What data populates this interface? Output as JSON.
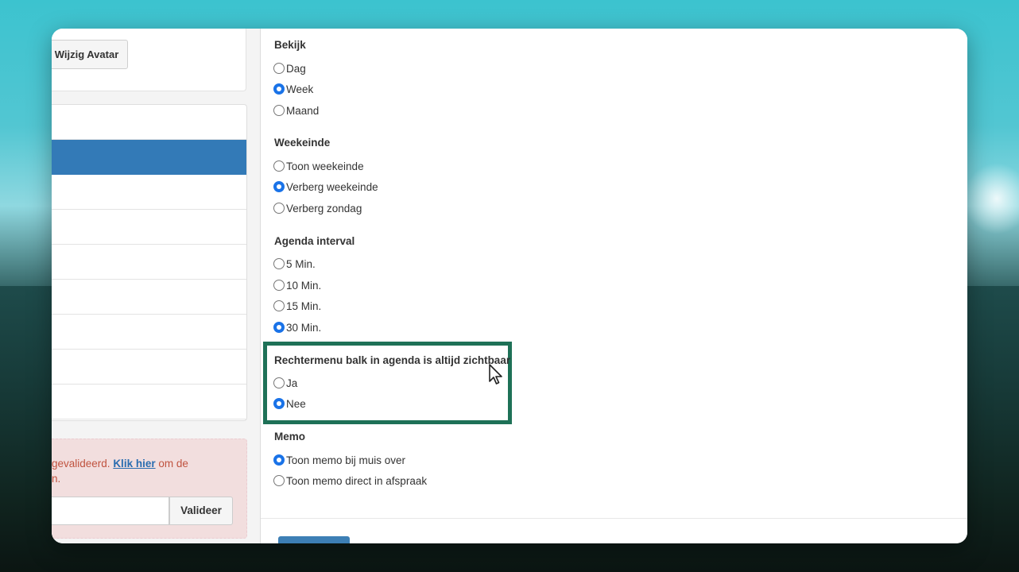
{
  "left": {
    "avatar_button_label": "Wijzig Avatar",
    "alert": {
      "text_prefix": "gevalideerd. ",
      "link_text": "Klik hier",
      "text_suffix": " om de",
      "line2": "n.",
      "validate_button": "Valideer",
      "input_value": ""
    }
  },
  "settings": {
    "view": {
      "title": "Bekijk",
      "options": [
        {
          "label": "Dag",
          "checked": false
        },
        {
          "label": "Week",
          "checked": true
        },
        {
          "label": "Maand",
          "checked": false
        }
      ]
    },
    "weekend": {
      "title": "Weekeinde",
      "options": [
        {
          "label": "Toon weekeinde",
          "checked": false
        },
        {
          "label": "Verberg weekeinde",
          "checked": true
        },
        {
          "label": "Verberg zondag",
          "checked": false
        }
      ]
    },
    "interval": {
      "title": "Agenda interval",
      "options": [
        {
          "label": "5 Min.",
          "checked": false
        },
        {
          "label": "10 Min.",
          "checked": false
        },
        {
          "label": "15 Min.",
          "checked": false
        },
        {
          "label": "30 Min.",
          "checked": true
        }
      ]
    },
    "right_menu": {
      "title": "Rechtermenu balk in agenda is altijd zichtbaar",
      "options": [
        {
          "label": "Ja",
          "checked": false
        },
        {
          "label": "Nee",
          "checked": true
        }
      ]
    },
    "memo": {
      "title": "Memo",
      "options": [
        {
          "label": "Toon memo bij muis over",
          "checked": true
        },
        {
          "label": "Toon memo direct in afspraak",
          "checked": false
        }
      ]
    }
  },
  "colors": {
    "accent": "#1a73e8",
    "active_menu": "#337ab7",
    "highlight_border": "#1e7157",
    "alert_text": "#c0533f",
    "alert_bg": "#f2dede"
  }
}
